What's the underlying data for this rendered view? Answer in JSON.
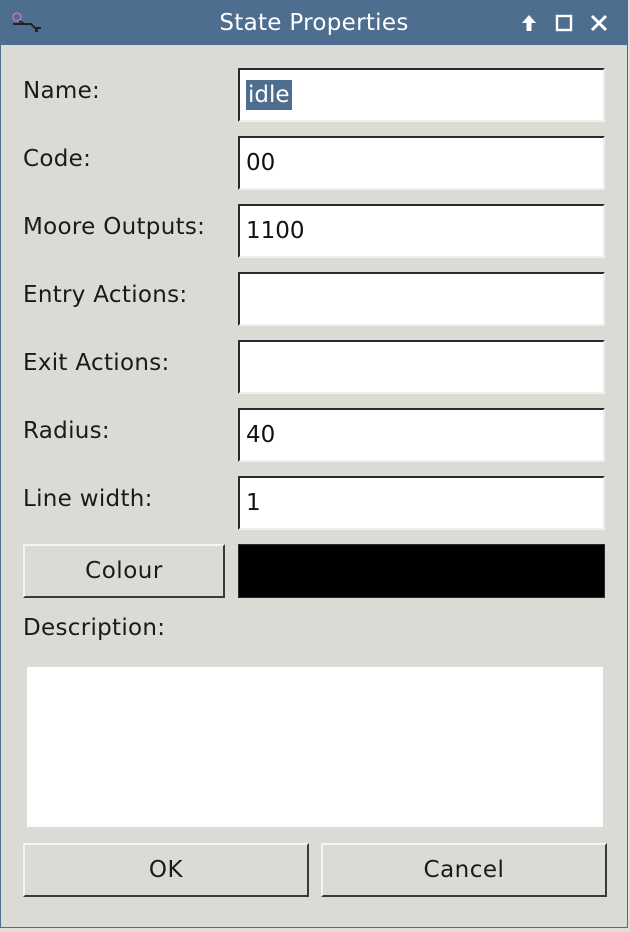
{
  "window": {
    "title": "State Properties",
    "controls": [
      "up-arrow-icon",
      "maximize-icon",
      "close-icon"
    ]
  },
  "fields": {
    "name": {
      "label": "Name:",
      "value": "idle",
      "selected": true
    },
    "code": {
      "label": "Code:",
      "value": "00"
    },
    "moore_outputs": {
      "label": "Moore Outputs:",
      "value": "1100"
    },
    "entry_actions": {
      "label": "Entry Actions:",
      "value": ""
    },
    "exit_actions": {
      "label": "Exit Actions:",
      "value": ""
    },
    "radius": {
      "label": "Radius:",
      "value": "40"
    },
    "line_width": {
      "label": "Line width:",
      "value": "1"
    }
  },
  "colour": {
    "button_label": "Colour",
    "value": "#000000"
  },
  "description": {
    "label": "Description:",
    "value": ""
  },
  "buttons": {
    "ok": "OK",
    "cancel": "Cancel"
  },
  "colors": {
    "titlebar": "#4d6e8e",
    "background": "#dcdad5",
    "selection": "#4d6e8e"
  }
}
